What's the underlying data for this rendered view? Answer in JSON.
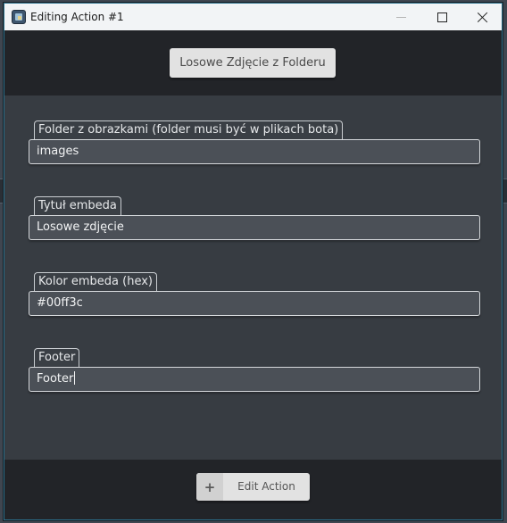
{
  "window": {
    "title": "Editing Action #1",
    "icon": "app-icon",
    "controls": [
      "minimize-icon",
      "maximize-icon",
      "close-icon"
    ]
  },
  "header": {
    "button_label": "Losowe Zdjęcie z Folderu"
  },
  "fields": [
    {
      "label": "Folder z obrazkami (folder musi być w plikach bota)",
      "value": "images"
    },
    {
      "label": "Tytuł embeda",
      "value": "Losowe zdjęcie"
    },
    {
      "label": "Kolor embeda (hex)",
      "value": "#00ff3c"
    },
    {
      "label": "Footer",
      "value": "Footer",
      "focused": true
    }
  ],
  "footer": {
    "plus_icon": "+",
    "button_label": "Edit Action"
  },
  "colors": {
    "titlebar": "#f2f4f6",
    "header_band": "#222428",
    "content_bg": "#373c42",
    "input_bg": "#4b5057",
    "button_bg": "#e2e2e2"
  }
}
